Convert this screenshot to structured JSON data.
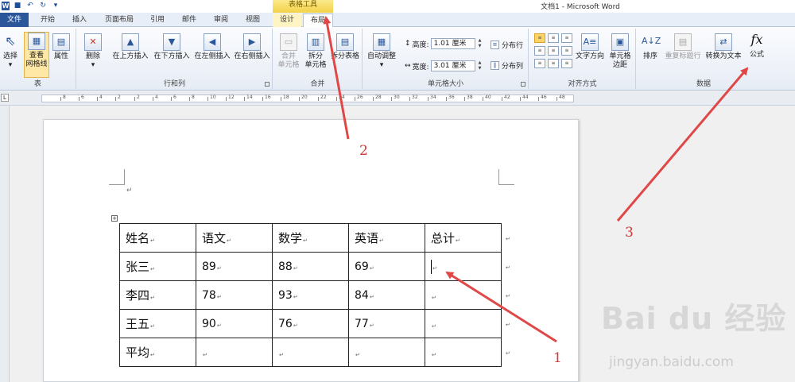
{
  "window": {
    "title": "文档1 - Microsoft Word",
    "context_tab_group": "表格工具"
  },
  "tabs": [
    {
      "label": "文件"
    },
    {
      "label": "开始"
    },
    {
      "label": "插入"
    },
    {
      "label": "页面布局"
    },
    {
      "label": "引用"
    },
    {
      "label": "邮件"
    },
    {
      "label": "审阅"
    },
    {
      "label": "视图"
    },
    {
      "label": "设计"
    },
    {
      "label": "布局"
    }
  ],
  "ribbon": {
    "table_group": {
      "label": "表",
      "select": "选择",
      "view_gridlines_1": "查看",
      "view_gridlines_2": "网格线",
      "properties": "属性"
    },
    "rows_cols_group": {
      "label": "行和列",
      "delete": "删除",
      "insert_above": "在上方插入",
      "insert_below": "在下方插入",
      "insert_left": "在左侧插入",
      "insert_right": "在右侧插入"
    },
    "merge_group": {
      "label": "合并",
      "merge_1": "合并",
      "merge_2": "单元格",
      "split_1": "拆分",
      "split_2": "单元格",
      "split_table": "拆分表格"
    },
    "cell_size_group": {
      "label": "单元格大小",
      "autofit": "自动调整",
      "height_label": "高度:",
      "height_value": "1.01 厘米",
      "width_label": "宽度:",
      "width_value": "3.01 厘米",
      "distribute_rows": "分布行",
      "distribute_cols": "分布列"
    },
    "alignment_group": {
      "label": "对齐方式",
      "text_direction": "文字方向",
      "cell_margins_1": "单元格",
      "cell_margins_2": "边距"
    },
    "data_group": {
      "label": "数据",
      "sort": "排序",
      "repeat_header": "重复标题行",
      "convert_to_text": "转换为文本",
      "formula": "公式"
    }
  },
  "ruler_labels": [
    "8",
    "6",
    "4",
    "2",
    "2",
    "4",
    "6",
    "8",
    "10",
    "12",
    "14",
    "16",
    "18",
    "20",
    "22",
    "24",
    "26",
    "28",
    "30",
    "32",
    "34",
    "36",
    "38",
    "40",
    "42",
    "44",
    "46",
    "48"
  ],
  "table": {
    "header": [
      "姓名",
      "语文",
      "数学",
      "英语",
      "总计"
    ],
    "rows": [
      [
        "张三",
        "89",
        "88",
        "69",
        ""
      ],
      [
        "李四",
        "78",
        "93",
        "84",
        ""
      ],
      [
        "王五",
        "90",
        "76",
        "77",
        ""
      ],
      [
        "平均",
        "",
        "",
        "",
        ""
      ]
    ]
  },
  "annotations": {
    "label_1": "1",
    "label_2": "2",
    "label_3": "3",
    "color": "#d23a3a"
  },
  "watermark": {
    "logo": "Bai du 经验",
    "url": "jingyan.baidu.com"
  },
  "symbols": {
    "paragraph_mark": "↵",
    "fx": "fx"
  }
}
